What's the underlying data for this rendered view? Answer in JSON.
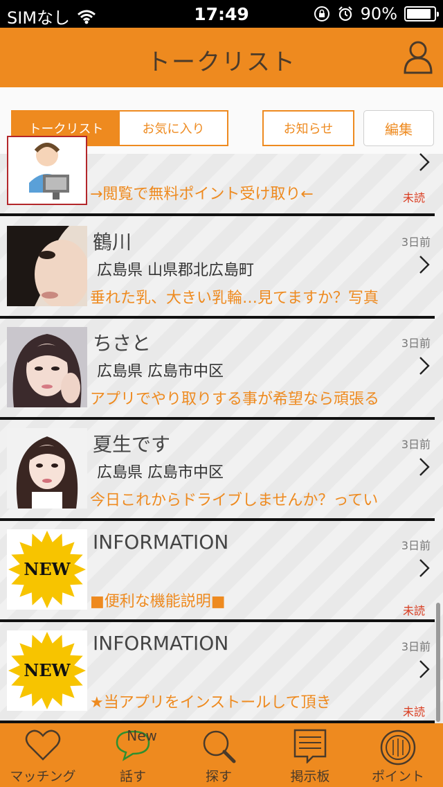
{
  "status_bar": {
    "carrier": "SIMなし",
    "time": "17:49",
    "battery": "90%",
    "battery_level": 0.9
  },
  "header": {
    "title": "トークリスト"
  },
  "segments": [
    {
      "label": "トークリスト",
      "active": true
    },
    {
      "label": "お気に入り",
      "active": false
    }
  ],
  "notice_button": {
    "label": "お知らせ"
  },
  "edit_button": {
    "label": "編集"
  },
  "conversations": [
    {
      "name": "",
      "date": "",
      "location": "",
      "message": "→閲覧で無料ポイント受け取り←",
      "unread": "未読"
    },
    {
      "name": "鶴川",
      "date": "3日前",
      "location": "広島県 山県郡北広島町",
      "message": "垂れた乳、大きい乳輪…見てますか？写真",
      "unread": ""
    },
    {
      "name": "ちさと",
      "date": "3日前",
      "location": "広島県 広島市中区",
      "message": "アプリでやり取りする事が希望なら頑張る",
      "unread": ""
    },
    {
      "name": "夏生です",
      "date": "3日前",
      "location": "広島県 広島市中区",
      "message": "今日これからドライブしませんか？ってい",
      "unread": ""
    },
    {
      "name": "INFORMATION",
      "date": "3日前",
      "location": "",
      "message": "■便利な機能説明■",
      "unread": "未読",
      "badge": "NEW"
    },
    {
      "name": "INFORMATION",
      "date": "3日前",
      "location": "",
      "message": "★当アプリをインストールして頂き",
      "unread": "未読",
      "badge": "NEW"
    }
  ],
  "tab_bar": {
    "new_label": "New",
    "items": [
      {
        "label": "マッチング",
        "icon": "heart-icon"
      },
      {
        "label": "話す",
        "icon": "speech-bubble-icon"
      },
      {
        "label": "探す",
        "icon": "magnifier-icon"
      },
      {
        "label": "掲示板",
        "icon": "board-icon"
      },
      {
        "label": "ポイント",
        "icon": "coin-icon"
      }
    ]
  },
  "colors": {
    "accent": "#ee8a1f",
    "unread": "#d93b1f",
    "separator": "#111111"
  }
}
